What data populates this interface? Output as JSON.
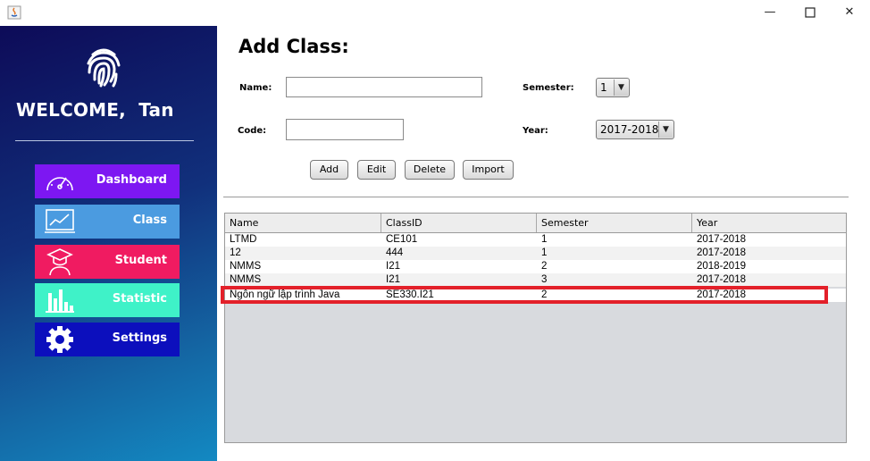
{
  "window": {
    "title_icon": "java-icon",
    "controls": [
      "minimize-icon",
      "maximize-icon",
      "close-icon"
    ]
  },
  "sidebar": {
    "welcome": "WELCOME,  Tan",
    "logo_icon": "fingerprint-icon",
    "items": [
      {
        "label": "Dashboard",
        "icon": "speedometer-icon",
        "color": "#7d17f2"
      },
      {
        "label": "Class",
        "icon": "chart-screen-icon",
        "color": "#4b9be0"
      },
      {
        "label": "Student",
        "icon": "graduate-icon",
        "color": "#f01b61"
      },
      {
        "label": "Statistic",
        "icon": "bar-chart-icon",
        "color": "#3ff2c8"
      },
      {
        "label": "Settings",
        "icon": "gear-icon",
        "color": "#0c0fbd"
      }
    ]
  },
  "form": {
    "title": "Add Class:",
    "name_label": "Name:",
    "name_value": "",
    "code_label": "Code:",
    "code_value": "",
    "semester_label": "Semester:",
    "semester_value": "1",
    "year_label": "Year:",
    "year_value": "2017-2018",
    "buttons": {
      "add": "Add",
      "edit": "Edit",
      "delete": "Delete",
      "import": "Import"
    }
  },
  "table": {
    "columns": [
      "Name",
      "ClassID",
      "Semester",
      "Year"
    ],
    "rows": [
      [
        "LTMD",
        "CE101",
        "1",
        "2017-2018"
      ],
      [
        "12",
        "444",
        "1",
        "2017-2018"
      ],
      [
        "NMMS",
        "I21",
        "2",
        "2018-2019"
      ],
      [
        "NMMS",
        "I21",
        "3",
        "2017-2018"
      ],
      [
        "Ngôn ngữ lập trình Java",
        "SE330.I21",
        "2",
        "2017-2018"
      ]
    ],
    "highlight_color": "#e3202a"
  }
}
